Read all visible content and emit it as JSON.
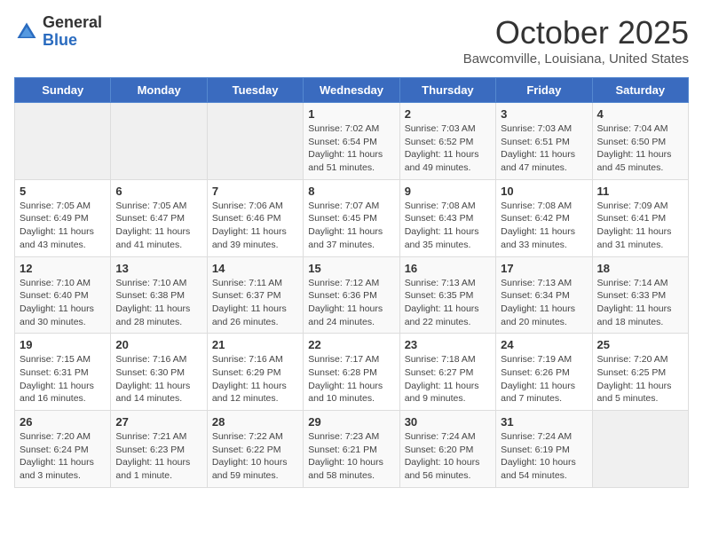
{
  "header": {
    "logo_line1": "General",
    "logo_line2": "Blue",
    "month": "October 2025",
    "location": "Bawcomville, Louisiana, United States"
  },
  "weekdays": [
    "Sunday",
    "Monday",
    "Tuesday",
    "Wednesday",
    "Thursday",
    "Friday",
    "Saturday"
  ],
  "weeks": [
    [
      {
        "day": "",
        "info": ""
      },
      {
        "day": "",
        "info": ""
      },
      {
        "day": "",
        "info": ""
      },
      {
        "day": "1",
        "info": "Sunrise: 7:02 AM\nSunset: 6:54 PM\nDaylight: 11 hours and 51 minutes."
      },
      {
        "day": "2",
        "info": "Sunrise: 7:03 AM\nSunset: 6:52 PM\nDaylight: 11 hours and 49 minutes."
      },
      {
        "day": "3",
        "info": "Sunrise: 7:03 AM\nSunset: 6:51 PM\nDaylight: 11 hours and 47 minutes."
      },
      {
        "day": "4",
        "info": "Sunrise: 7:04 AM\nSunset: 6:50 PM\nDaylight: 11 hours and 45 minutes."
      }
    ],
    [
      {
        "day": "5",
        "info": "Sunrise: 7:05 AM\nSunset: 6:49 PM\nDaylight: 11 hours and 43 minutes."
      },
      {
        "day": "6",
        "info": "Sunrise: 7:05 AM\nSunset: 6:47 PM\nDaylight: 11 hours and 41 minutes."
      },
      {
        "day": "7",
        "info": "Sunrise: 7:06 AM\nSunset: 6:46 PM\nDaylight: 11 hours and 39 minutes."
      },
      {
        "day": "8",
        "info": "Sunrise: 7:07 AM\nSunset: 6:45 PM\nDaylight: 11 hours and 37 minutes."
      },
      {
        "day": "9",
        "info": "Sunrise: 7:08 AM\nSunset: 6:43 PM\nDaylight: 11 hours and 35 minutes."
      },
      {
        "day": "10",
        "info": "Sunrise: 7:08 AM\nSunset: 6:42 PM\nDaylight: 11 hours and 33 minutes."
      },
      {
        "day": "11",
        "info": "Sunrise: 7:09 AM\nSunset: 6:41 PM\nDaylight: 11 hours and 31 minutes."
      }
    ],
    [
      {
        "day": "12",
        "info": "Sunrise: 7:10 AM\nSunset: 6:40 PM\nDaylight: 11 hours and 30 minutes."
      },
      {
        "day": "13",
        "info": "Sunrise: 7:10 AM\nSunset: 6:38 PM\nDaylight: 11 hours and 28 minutes."
      },
      {
        "day": "14",
        "info": "Sunrise: 7:11 AM\nSunset: 6:37 PM\nDaylight: 11 hours and 26 minutes."
      },
      {
        "day": "15",
        "info": "Sunrise: 7:12 AM\nSunset: 6:36 PM\nDaylight: 11 hours and 24 minutes."
      },
      {
        "day": "16",
        "info": "Sunrise: 7:13 AM\nSunset: 6:35 PM\nDaylight: 11 hours and 22 minutes."
      },
      {
        "day": "17",
        "info": "Sunrise: 7:13 AM\nSunset: 6:34 PM\nDaylight: 11 hours and 20 minutes."
      },
      {
        "day": "18",
        "info": "Sunrise: 7:14 AM\nSunset: 6:33 PM\nDaylight: 11 hours and 18 minutes."
      }
    ],
    [
      {
        "day": "19",
        "info": "Sunrise: 7:15 AM\nSunset: 6:31 PM\nDaylight: 11 hours and 16 minutes."
      },
      {
        "day": "20",
        "info": "Sunrise: 7:16 AM\nSunset: 6:30 PM\nDaylight: 11 hours and 14 minutes."
      },
      {
        "day": "21",
        "info": "Sunrise: 7:16 AM\nSunset: 6:29 PM\nDaylight: 11 hours and 12 minutes."
      },
      {
        "day": "22",
        "info": "Sunrise: 7:17 AM\nSunset: 6:28 PM\nDaylight: 11 hours and 10 minutes."
      },
      {
        "day": "23",
        "info": "Sunrise: 7:18 AM\nSunset: 6:27 PM\nDaylight: 11 hours and 9 minutes."
      },
      {
        "day": "24",
        "info": "Sunrise: 7:19 AM\nSunset: 6:26 PM\nDaylight: 11 hours and 7 minutes."
      },
      {
        "day": "25",
        "info": "Sunrise: 7:20 AM\nSunset: 6:25 PM\nDaylight: 11 hours and 5 minutes."
      }
    ],
    [
      {
        "day": "26",
        "info": "Sunrise: 7:20 AM\nSunset: 6:24 PM\nDaylight: 11 hours and 3 minutes."
      },
      {
        "day": "27",
        "info": "Sunrise: 7:21 AM\nSunset: 6:23 PM\nDaylight: 11 hours and 1 minute."
      },
      {
        "day": "28",
        "info": "Sunrise: 7:22 AM\nSunset: 6:22 PM\nDaylight: 10 hours and 59 minutes."
      },
      {
        "day": "29",
        "info": "Sunrise: 7:23 AM\nSunset: 6:21 PM\nDaylight: 10 hours and 58 minutes."
      },
      {
        "day": "30",
        "info": "Sunrise: 7:24 AM\nSunset: 6:20 PM\nDaylight: 10 hours and 56 minutes."
      },
      {
        "day": "31",
        "info": "Sunrise: 7:24 AM\nSunset: 6:19 PM\nDaylight: 10 hours and 54 minutes."
      },
      {
        "day": "",
        "info": ""
      }
    ]
  ]
}
